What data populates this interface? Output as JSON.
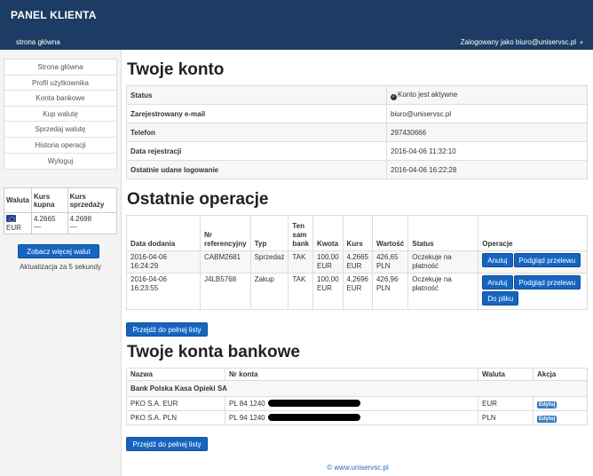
{
  "header": {
    "brand": "PANEL KLIENTA",
    "home_link": "strona główna",
    "user_link": "Zalogowany jako biuro@uniservsc.pl"
  },
  "sidebar": {
    "items": [
      "Strona główna",
      "Profil użytkownika",
      "Konta bankowe",
      "Kup walutę",
      "Sprzedaj walutę",
      "Historia operacji",
      "Wyloguj"
    ],
    "rates": {
      "headers": [
        "Waluta",
        "Kurs kupna",
        "Kurs sprzedaży"
      ],
      "rows": [
        {
          "currency": "EUR",
          "buy": "4.2665",
          "sell": "4.2698",
          "buy_change": "—",
          "sell_change": "—"
        }
      ]
    },
    "more_button": "Zobacz więcej walut",
    "refresh_text": "Aktualizacja za 5 sekundy"
  },
  "account": {
    "title": "Twoje konto",
    "rows": [
      {
        "label": "Status",
        "value": "Konto jest aktywne"
      },
      {
        "label": "Zarejestrowany e-mail",
        "value": "biuro@uniservsc.pl"
      },
      {
        "label": "Telefon",
        "value": "297430666"
      },
      {
        "label": "Data rejestracji",
        "value": "2016-04-06 11:32:10"
      },
      {
        "label": "Ostatnie udane logowanie",
        "value": "2016-04-06 16:22:28"
      }
    ]
  },
  "operations": {
    "title": "Ostatnie operacje",
    "headers": [
      "Data dodania",
      "Nr referencyjny",
      "Typ",
      "Ten sam bank",
      "Kwota",
      "Kurs",
      "Wartość",
      "Status",
      "Operacje"
    ],
    "rows": [
      {
        "date": "2016-04-06 16:24:29",
        "ref": "CABM2681",
        "type": "Sprzedaż",
        "same_bank": "TAK",
        "amount": "100,00 EUR",
        "rate": "4,2665 EUR",
        "value": "426,65 PLN",
        "status": "Oczekuje na płatność"
      },
      {
        "date": "2016-04-06 16:23:55",
        "ref": "J4LB5768",
        "type": "Zakup",
        "same_bank": "TAK",
        "amount": "100,00 EUR",
        "rate": "4,2696 EUR",
        "value": "426,96 PLN",
        "status": "Oczekuje na płatność"
      }
    ],
    "cancel_label": "Anuluj",
    "preview_label": "Podgląd przelewu",
    "file_label": "Do pliku",
    "full_list_label": "Przejdź do pełnej listy"
  },
  "banks": {
    "title": "Twoje konta bankowe",
    "headers": [
      "Nazwa",
      "Nr konta",
      "Waluta",
      "Akcja"
    ],
    "group": "Bank Polska Kasa Opieki SA",
    "rows": [
      {
        "name": "PKO S.A. EUR",
        "account": "PL 84 1240",
        "currency": "EUR",
        "action": "Edytuj"
      },
      {
        "name": "PKO S.A. PLN",
        "account": "PL 94 1240",
        "currency": "PLN",
        "action": "Edytuj"
      }
    ],
    "full_list_label": "Przejdź do pełnej listy"
  },
  "footer": {
    "text": "© www.uniservsc.pl"
  }
}
